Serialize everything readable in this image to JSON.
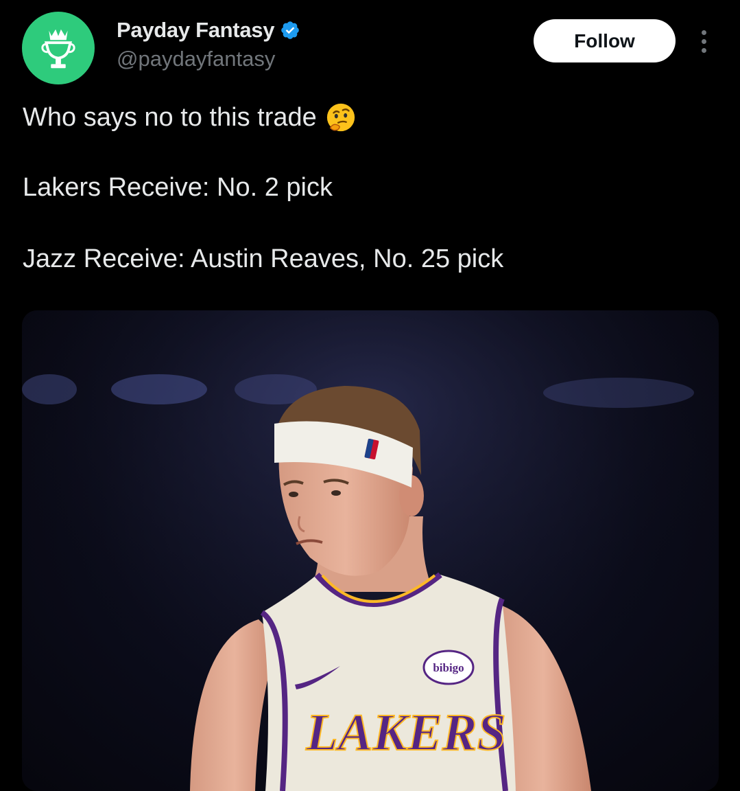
{
  "author": {
    "display_name": "Payday Fantasy",
    "handle": "@paydayfantasy",
    "avatar_icon": "trophy-crown-icon",
    "avatar_color": "#2ecb7c",
    "verified_icon": "verified-badge-icon",
    "verified_color": "#1d9bf0"
  },
  "actions": {
    "follow_label": "Follow",
    "more_icon": "more-vertical-icon"
  },
  "tweet": {
    "line1": "Who says no to this trade",
    "line1_emoji": "thinking-face-emoji",
    "line2": "Lakers Receive: No. 2 pick",
    "line3": "Jazz Receive: Austin Reaves, No. 25 pick"
  },
  "media": {
    "jersey_wordmark": "LAKERS",
    "jersey_patch": "bibigo"
  },
  "colors": {
    "background": "#000000",
    "text": "#e7e9ea",
    "muted": "#71767b",
    "lakers_purple": "#552583",
    "lakers_gold": "#fdb927"
  }
}
